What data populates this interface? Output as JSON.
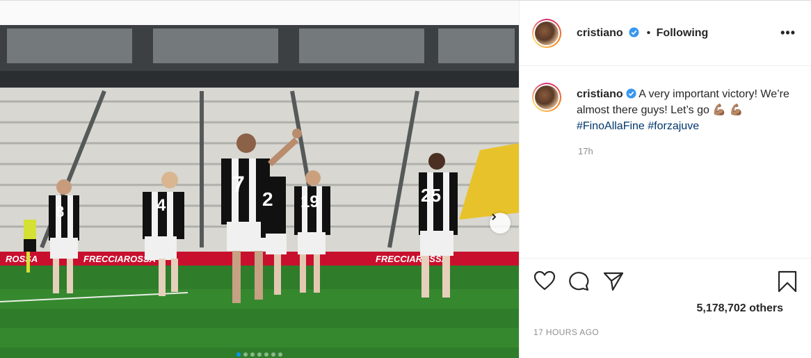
{
  "author": {
    "username": "cristiano",
    "verified": true,
    "separator": "•",
    "follow_status": "Following"
  },
  "header": {
    "more_icon": "more-options-icon",
    "more_label": "•••"
  },
  "caption": {
    "username": "cristiano",
    "text_line": "A very important victory! We’re almost there guys! Let’s go",
    "emoji_1": "💪🏽",
    "emoji_2": "💪🏽",
    "hashtags": [
      "#FinoAllaFine",
      "#forzajuve"
    ],
    "time": "17h"
  },
  "photo": {
    "description_banners": [
      "FRECCIAROSSA",
      "FRECCIAROSSA",
      "FRECCIA"
    ],
    "jersey_numbers": [
      "8",
      "4",
      "7",
      "2",
      "19",
      "25"
    ],
    "carousel": {
      "count": 7,
      "active_index": 0
    }
  },
  "actions": {
    "like_icon": "heart-icon",
    "comment_icon": "comment-icon",
    "share_icon": "share-icon",
    "save_icon": "bookmark-icon"
  },
  "likes": "5,178,702 others",
  "timestamp": "17 HOURS AGO",
  "colors": {
    "link": "#00376b",
    "accent": "#0095f6",
    "muted": "#8e8e8e"
  }
}
